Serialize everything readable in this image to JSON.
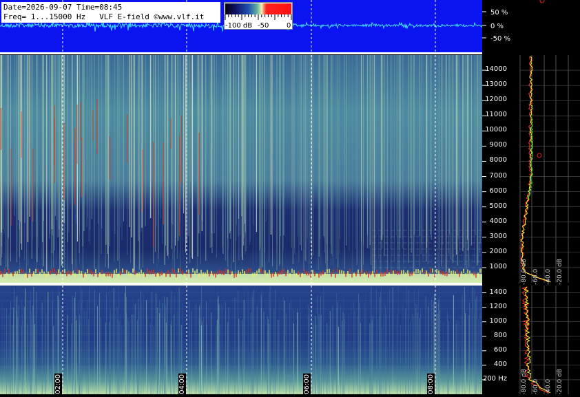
{
  "header": {
    "line1": "Date=2026-09-07 Time=08:45",
    "line2": "Freq= 1...15000 Hz   VLF E-field ©www.vlf.it"
  },
  "colorbar": {
    "labels": [
      "-100 dB",
      "-50",
      "0"
    ]
  },
  "waveform_scale": {
    "labels": [
      "50 %",
      "0 %",
      "-50 %"
    ]
  },
  "chart_data": [
    {
      "type": "heatmap",
      "name_hint": "spectrogram-upper",
      "y_unit": "Hz",
      "yticks": [
        1000,
        2000,
        3000,
        4000,
        5000,
        6000,
        7000,
        8000,
        9000,
        10000,
        11000,
        12000,
        13000,
        14000
      ],
      "ylim": [
        0,
        15000
      ],
      "time_ticks": [
        "02:00",
        "04:00",
        "06:00",
        "08:00"
      ]
    },
    {
      "type": "heatmap",
      "name_hint": "spectrogram-lower",
      "yticks": [
        200,
        400,
        600,
        800,
        1000,
        1200,
        1400
      ],
      "ytick_labels": [
        "200 Hz",
        "400",
        "600",
        "800",
        "1000",
        "1200",
        "1400"
      ],
      "ylim": [
        0,
        1500
      ]
    },
    {
      "type": "line",
      "name_hint": "spectrum-profile",
      "x_tick_labels": [
        "-80.0 dB",
        "-60.0",
        "-40.0",
        "-20.0 dB"
      ]
    }
  ],
  "colors": {
    "waveform_bg": "#0a14f0",
    "waveform_trace": "#40e0ff",
    "spectrum_yellow": "#ffff40",
    "spectrum_red": "#ff3020",
    "spectrum_green": "#30d040"
  }
}
